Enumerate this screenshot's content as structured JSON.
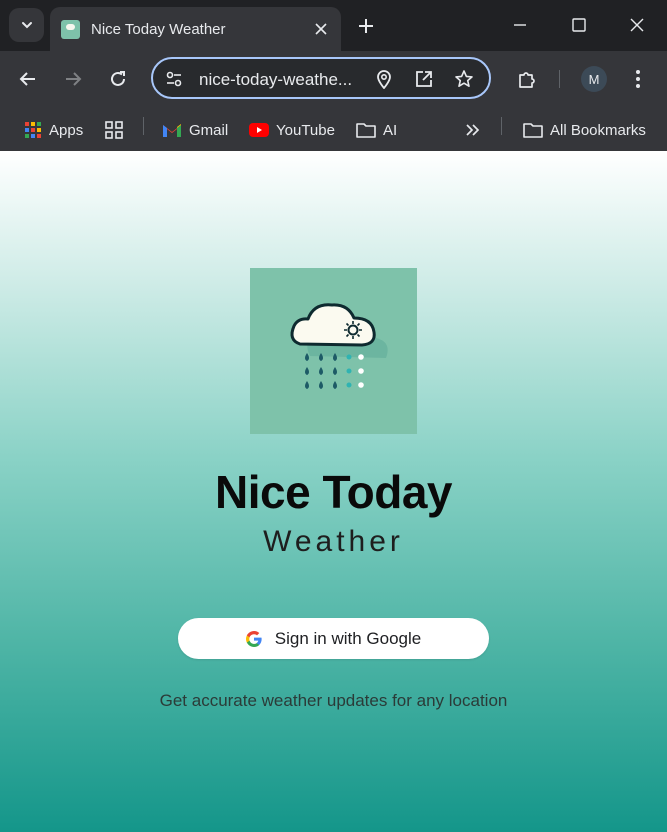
{
  "browser": {
    "tab_title": "Nice Today Weather",
    "url": "nice-today-weathe...",
    "profile_initial": "M",
    "bookmarks": {
      "apps": "Apps",
      "gmail": "Gmail",
      "youtube": "YouTube",
      "ai": "AI",
      "all_bookmarks": "All Bookmarks"
    }
  },
  "page": {
    "title": "Nice Today",
    "subtitle": "Weather",
    "signin_label": "Sign in with Google",
    "tagline": "Get accurate weather updates for any location"
  },
  "icons": {
    "tab_search": "chevron-down-icon",
    "tab_close": "close-icon",
    "new_tab": "plus-icon",
    "back": "back-arrow-icon",
    "forward": "forward-arrow-icon",
    "reload": "reload-icon",
    "site_settings": "tune-icon",
    "location": "location-pin-icon",
    "open_in_app": "open-external-icon",
    "bookmark_star": "star-icon",
    "extensions": "puzzle-icon",
    "menu": "more-vert-icon",
    "overflow": "double-chevron-icon"
  },
  "colors": {
    "accent": "#a8c7fa",
    "page_gradient_top": "#ffffff",
    "page_gradient_bottom": "#14968a",
    "logo_bg": "#7ec2aa"
  }
}
